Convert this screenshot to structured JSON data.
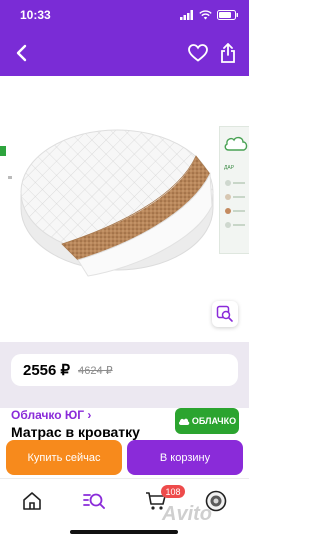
{
  "status_bar": {
    "time": "10:33"
  },
  "nav": {
    "back_icon": "chevron-left-icon",
    "favorite_icon": "heart-icon",
    "share_icon": "share-icon"
  },
  "gallery": {
    "image": "round-mattress-photo",
    "side_tag": "ДАР"
  },
  "price": {
    "current": "2556 ₽",
    "old": "4624 ₽"
  },
  "seller": {
    "name": "Облачко ЮГ ›"
  },
  "listing": {
    "title": "Матрас в кроватку"
  },
  "shop_badge": {
    "label": "ОБЛАЧКО"
  },
  "actions": {
    "buy_now": "Купить сейчас",
    "to_cart": "В корзину"
  },
  "bottom_nav": {
    "cart_count": "108",
    "watermark": "Avito",
    "icons": [
      "home-icon",
      "search-icon",
      "cart-icon",
      "profile-icon"
    ]
  },
  "colors": {
    "brand": "#7a2cd6",
    "accent": "#8a2bd9",
    "orange": "#f78a1c",
    "green": "#2ba42f",
    "badge": "#ee4b4b"
  }
}
